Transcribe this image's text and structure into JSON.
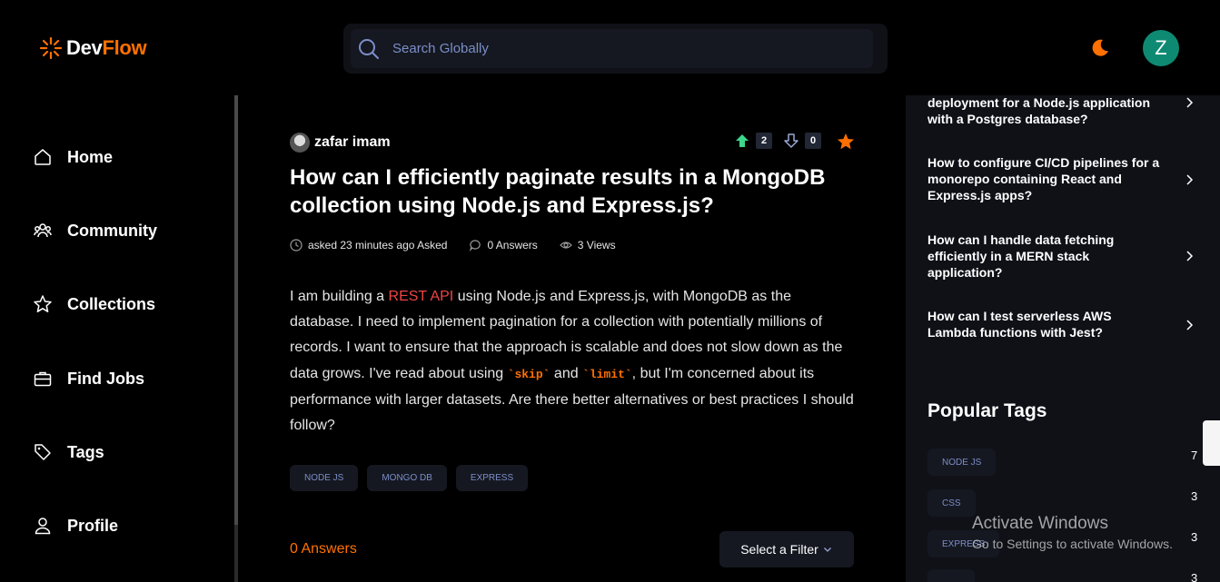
{
  "brand": {
    "name_part1": "Dev",
    "name_part2": "Flow",
    "accent": "#ff7000"
  },
  "search": {
    "placeholder": "Search Globally",
    "value": ""
  },
  "user": {
    "avatar_initial": "Z",
    "avatar_color": "#0e8a73"
  },
  "sidebar": {
    "items": [
      {
        "label": "Home",
        "icon": "home-icon"
      },
      {
        "label": "Community",
        "icon": "users-icon"
      },
      {
        "label": "Collections",
        "icon": "star-icon"
      },
      {
        "label": "Find Jobs",
        "icon": "briefcase-icon"
      },
      {
        "label": "Tags",
        "icon": "tag-icon"
      },
      {
        "label": "Profile",
        "icon": "user-icon"
      }
    ]
  },
  "question": {
    "author": "zafar imam",
    "upvotes": "2",
    "downvotes": "0",
    "title": "How can I efficiently paginate results in a MongoDB collection using Node.js and Express.js?",
    "asked": "asked 23 minutes ago Asked",
    "answers": "0 Answers",
    "views": "3 Views",
    "body": {
      "p1": "I am building a ",
      "link": "REST API",
      "p2": " using Node.js and Express.js, with MongoDB as the database. I need to implement pagination for a collection with potentially millions of records. I want to ensure that the approach is scalable and does not slow down as the data grows. I've read about using ",
      "code1": "`skip`",
      "p3": " and ",
      "code2": "`limit`",
      "p4": ", but I'm concerned about its performance with larger datasets. Are there better alternatives or best practices I should follow?"
    },
    "tags": [
      "NODE JS",
      "MONGO DB",
      "EXPRESS"
    ]
  },
  "answers_section": {
    "count_label": "0 Answers",
    "filter_label": "Select a Filter"
  },
  "hot_questions": [
    "deployment for a Node.js application with a Postgres database?",
    "How to configure CI/CD pipelines for a monorepo containing React and Express.js apps?",
    "How can I handle data fetching efficiently in a MERN stack application?",
    "How can I test serverless AWS Lambda functions with Jest?"
  ],
  "popular_tags": {
    "title": "Popular Tags",
    "items": [
      {
        "name": "NODE JS",
        "count": "7"
      },
      {
        "name": "CSS",
        "count": "3"
      },
      {
        "name": "EXPRESS",
        "count": "3"
      },
      {
        "name": "",
        "count": "3"
      }
    ]
  },
  "watermark": {
    "line1": "Activate Windows",
    "line2": "Go to Settings to activate Windows."
  }
}
